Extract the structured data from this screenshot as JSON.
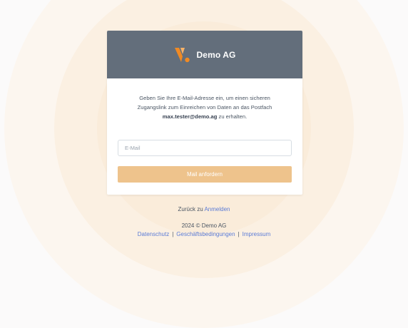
{
  "brand": {
    "name": "Demo AG",
    "accent": "#ee8a2a"
  },
  "intro": {
    "line1": "Geben Sie Ihre E-Mail-Adresse ein, um einen sicheren",
    "line2": "Zugangslink zum Einreichen von Daten an das Postfach",
    "email": "max.tester@demo.ag",
    "suffix": " zu erhalten."
  },
  "form": {
    "email_placeholder": "E-Mail",
    "email_value": "",
    "submit_label": "Mail anfordern"
  },
  "back": {
    "prefix": "Zurück zu ",
    "link": "Anmelden"
  },
  "footer": {
    "copyright": "2024 © Demo AG",
    "links": [
      "Datenschutz",
      "Geschäftsbedingungen",
      "Impressum"
    ],
    "separator": "|"
  },
  "colors": {
    "header_bg": "#636e7b",
    "button_bg": "#eec38c",
    "link": "#5b7bd6"
  }
}
